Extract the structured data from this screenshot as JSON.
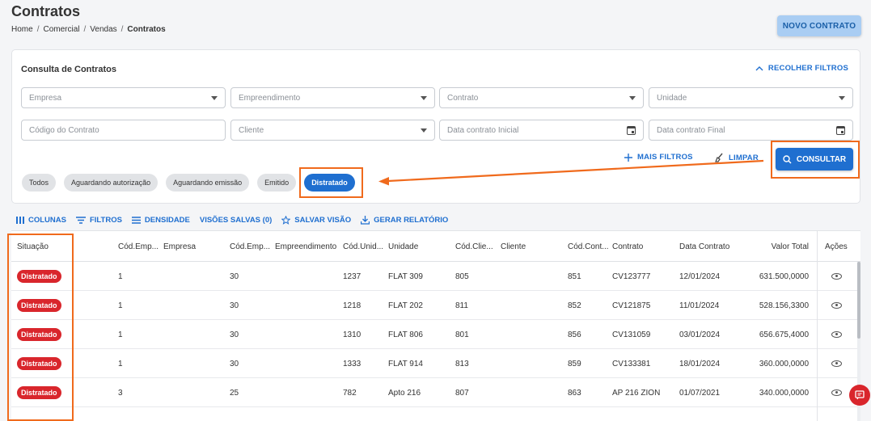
{
  "header": {
    "title": "Contratos",
    "breadcrumb": [
      "Home",
      "Comercial",
      "Vendas",
      "Contratos"
    ],
    "new_button": "NOVO CONTRATO"
  },
  "filters": {
    "title": "Consulta de Contratos",
    "collapse_label": "RECOLHER FILTROS",
    "fields": {
      "empresa": "Empresa",
      "empreendimento": "Empreendimento",
      "contrato": "Contrato",
      "unidade": "Unidade",
      "codigo_contrato": "Código do Contrato",
      "cliente": "Cliente",
      "data_inicial": "Data contrato Inicial",
      "data_final": "Data contrato Final"
    },
    "more_filters": "MAIS FILTROS",
    "clear": "LIMPAR",
    "consult": "CONSULTAR",
    "chips": [
      "Todos",
      "Aguardando autorização",
      "Aguardando emissão",
      "Emitido",
      "Distratado"
    ],
    "active_chip": "Distratado"
  },
  "toolbar": {
    "columns": "COLUNAS",
    "filters": "FILTROS",
    "density": "DENSIDADE",
    "saved_views": "VISÕES SALVAS (0)",
    "save_view": "SALVAR VISÃO",
    "report": "GERAR RELATÓRIO"
  },
  "table": {
    "columns": {
      "situacao": "Situação",
      "cod_emp": "Cód.Emp...",
      "empresa": "Empresa",
      "cod_empr": "Cód.Emp...",
      "empreendimento": "Empreendimento",
      "cod_unid": "Cód.Unid...",
      "unidade": "Unidade",
      "cod_cli": "Cód.Clie...",
      "cliente": "Cliente",
      "cod_cont": "Cód.Cont...",
      "contrato": "Contrato",
      "data_contrato": "Data Contrato",
      "valor_total": "Valor Total",
      "acoes": "Ações"
    },
    "rows": [
      {
        "situacao": "Distratado",
        "cod_emp": "1",
        "empresa": "",
        "cod_empr": "30",
        "empreendimento": "",
        "cod_unid": "1237",
        "unidade": "FLAT 309",
        "cod_cli": "805",
        "cliente": "",
        "cod_cont": "851",
        "contrato": "CV123777",
        "data": "12/01/2024",
        "valor": "631.500,0000"
      },
      {
        "situacao": "Distratado",
        "cod_emp": "1",
        "empresa": "",
        "cod_empr": "30",
        "empreendimento": "",
        "cod_unid": "1218",
        "unidade": "FLAT 202",
        "cod_cli": "811",
        "cliente": "",
        "cod_cont": "852",
        "contrato": "CV121875",
        "data": "11/01/2024",
        "valor": "528.156,3300"
      },
      {
        "situacao": "Distratado",
        "cod_emp": "1",
        "empresa": "",
        "cod_empr": "30",
        "empreendimento": "",
        "cod_unid": "1310",
        "unidade": "FLAT 806",
        "cod_cli": "801",
        "cliente": "",
        "cod_cont": "856",
        "contrato": "CV131059",
        "data": "03/01/2024",
        "valor": "656.675,4000"
      },
      {
        "situacao": "Distratado",
        "cod_emp": "1",
        "empresa": "",
        "cod_empr": "30",
        "empreendimento": "",
        "cod_unid": "1333",
        "unidade": "FLAT 914",
        "cod_cli": "813",
        "cliente": "",
        "cod_cont": "859",
        "contrato": "CV133381",
        "data": "18/01/2024",
        "valor": "360.000,0000"
      },
      {
        "situacao": "Distratado",
        "cod_emp": "3",
        "empresa": "",
        "cod_empr": "25",
        "empreendimento": "",
        "cod_unid": "782",
        "unidade": "Apto 216",
        "cod_cli": "807",
        "cliente": "",
        "cod_cont": "863",
        "contrato": "AP 216 ZION",
        "data": "01/07/2021",
        "valor": "340.000,0000"
      }
    ]
  },
  "colors": {
    "primary": "#1f6fd0",
    "status_red": "#d9262c",
    "highlight": "#f06a1c"
  },
  "icons": {
    "collapse": "chevron-up-icon",
    "more_filters": "plus-icon",
    "clear": "broom-icon",
    "consult": "search-icon",
    "columns": "columns-icon",
    "filters": "filter-icon",
    "density": "density-icon",
    "save_view": "star-icon",
    "report": "download-icon",
    "view": "eye-icon",
    "help": "chat-icon"
  }
}
